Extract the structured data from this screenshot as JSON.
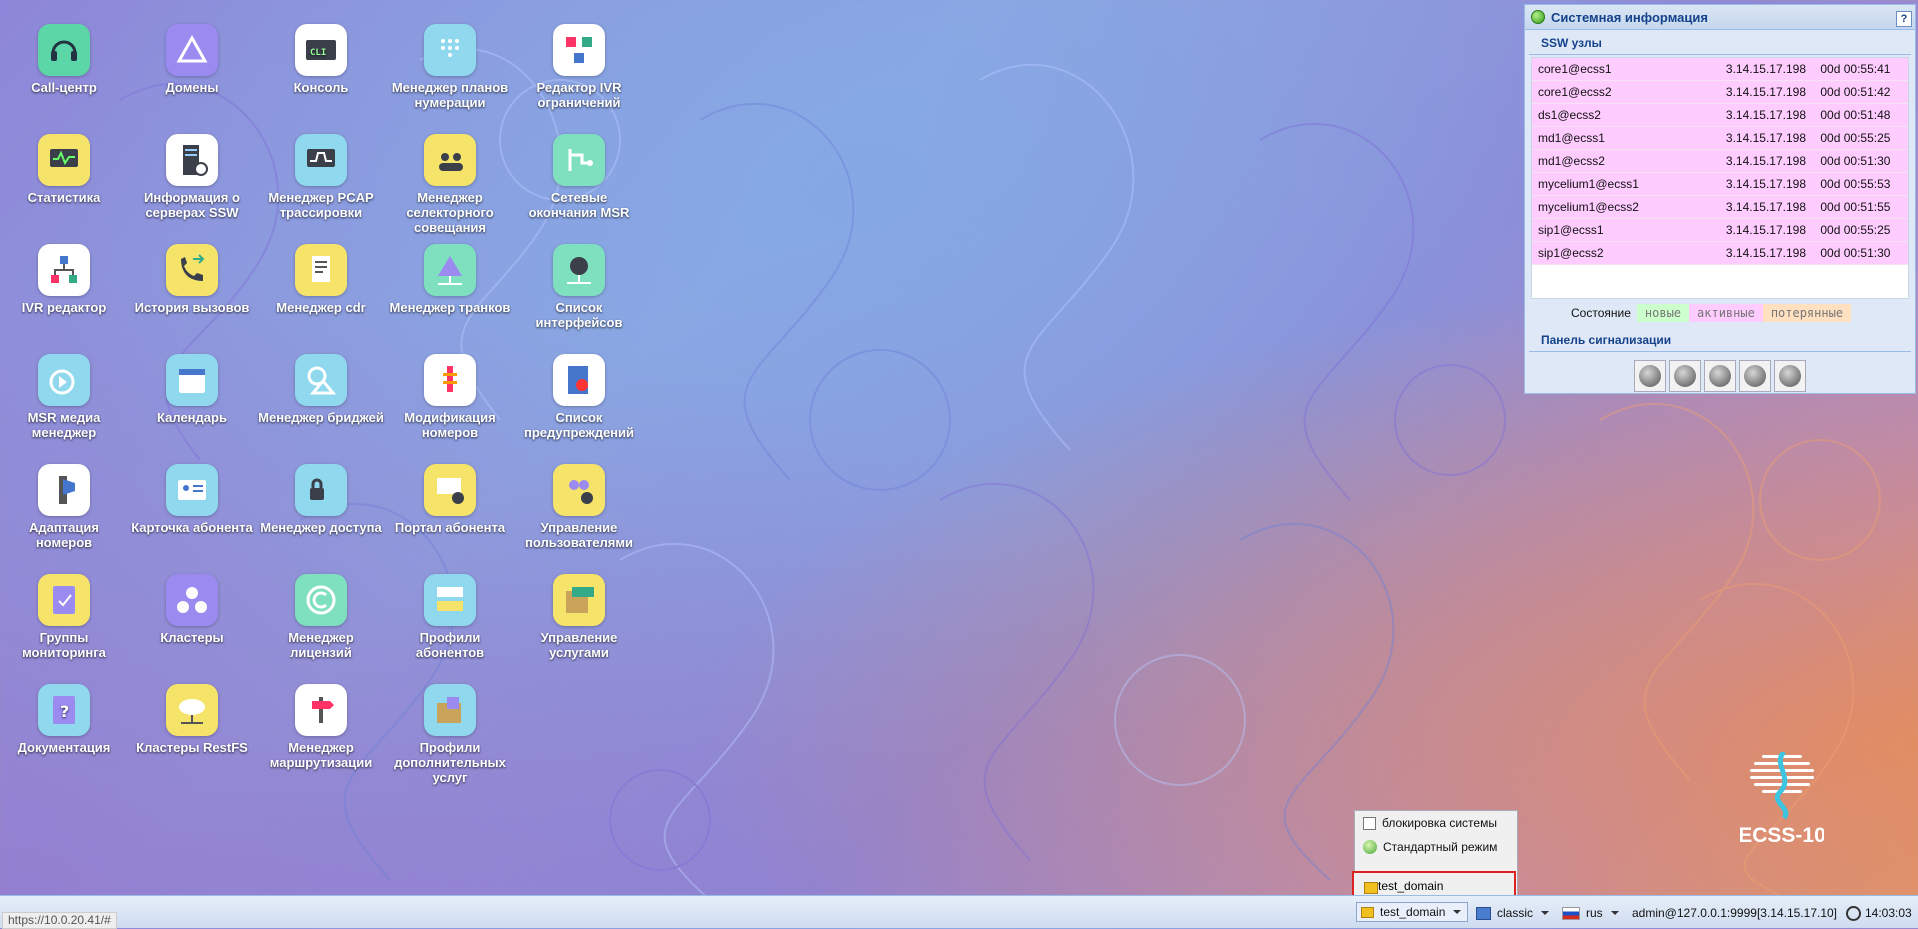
{
  "desktop": {
    "icons": [
      {
        "label": "Call-центр",
        "icon": "headset-icon",
        "color": "#5cd6a6"
      },
      {
        "label": "Домены",
        "icon": "triangle-icon",
        "color": "#9b8af0"
      },
      {
        "label": "Консоль",
        "icon": "cli-terminal-icon",
        "color": "#ffffff"
      },
      {
        "label": "Менеджер планов нумерации",
        "icon": "dialpad-phone-icon",
        "color": "#8fd8ee"
      },
      {
        "label": "Редактор IVR ограничений",
        "icon": "ivr-restriction-icon",
        "color": "#ffffff"
      },
      {
        "label": "Статистика",
        "icon": "monitor-chart-icon",
        "color": "#f5e36a"
      },
      {
        "label": "Информация о серверах SSW",
        "icon": "server-info-icon",
        "color": "#ffffff"
      },
      {
        "label": "Менеджер PCAP трассировки",
        "icon": "pcap-monitor-icon",
        "color": "#8fd8ee"
      },
      {
        "label": "Менеджер селекторного совещания",
        "icon": "conference-icon",
        "color": "#f5e36a"
      },
      {
        "label": "Сетевые окончания MSR",
        "icon": "network-endpoints-icon",
        "color": "#7fe0c0"
      },
      {
        "label": "IVR редактор",
        "icon": "ivr-tree-icon",
        "color": "#ffffff"
      },
      {
        "label": "История вызовов",
        "icon": "call-history-icon",
        "color": "#f5e36a"
      },
      {
        "label": "Менеджер cdr",
        "icon": "cdr-document-icon",
        "color": "#f5e36a"
      },
      {
        "label": "Менеджер транков",
        "icon": "trunk-icon",
        "color": "#7fe0c0"
      },
      {
        "label": "Список интерфейсов",
        "icon": "interfaces-icon",
        "color": "#7fe0c0"
      },
      {
        "label": "MSR медиа менеджер",
        "icon": "media-play-icon",
        "color": "#8fd8ee"
      },
      {
        "label": "Календарь",
        "icon": "calendar-icon",
        "color": "#8fd8ee"
      },
      {
        "label": "Менеджер бриджей",
        "icon": "bridge-shapes-icon",
        "color": "#8fd8ee"
      },
      {
        "label": "Модификация номеров",
        "icon": "number-modification-icon",
        "color": "#ffffff"
      },
      {
        "label": "Список предупреждений",
        "icon": "alarm-list-icon",
        "color": "#ffffff"
      },
      {
        "label": "Адаптация номеров",
        "icon": "number-adaptation-icon",
        "color": "#ffffff"
      },
      {
        "label": "Карточка абонента",
        "icon": "subscriber-card-icon",
        "color": "#8fd8ee"
      },
      {
        "label": "Менеджер доступа",
        "icon": "access-lock-icon",
        "color": "#8fd8ee"
      },
      {
        "label": "Портал абонента",
        "icon": "subscriber-portal-icon",
        "color": "#f5e36a"
      },
      {
        "label": "Управление пользователями",
        "icon": "users-gear-icon",
        "color": "#f5e36a"
      },
      {
        "label": "Группы мониторинга",
        "icon": "monitoring-groups-icon",
        "color": "#f5e36a"
      },
      {
        "label": "Кластеры",
        "icon": "clusters-icon",
        "color": "#9b8af0"
      },
      {
        "label": "Менеджер лицензий",
        "icon": "license-copyright-icon",
        "color": "#7fe0c0"
      },
      {
        "label": "Профили абонентов",
        "icon": "subscriber-profiles-icon",
        "color": "#8fd8ee"
      },
      {
        "label": "Управление услугами",
        "icon": "services-box-icon",
        "color": "#f5e36a"
      },
      {
        "label": "Документация",
        "icon": "documentation-book-icon",
        "color": "#8fd8ee"
      },
      {
        "label": "Кластеры RestFS",
        "icon": "restfs-cloud-icon",
        "color": "#f5e36a"
      },
      {
        "label": "Менеджер маршрутизации",
        "icon": "routing-signpost-icon",
        "color": "#ffffff"
      },
      {
        "label": "Профили дополнительных услуг",
        "icon": "additional-services-icon",
        "color": "#8fd8ee"
      }
    ]
  },
  "sysinfo": {
    "title": "Системная информация",
    "help": "?",
    "ssw_title": "SSW узлы",
    "nodes": [
      {
        "name": "core1@ecss1",
        "ip": "3.14.15.17.198",
        "uptime": "00d 00:55:41"
      },
      {
        "name": "core1@ecss2",
        "ip": "3.14.15.17.198",
        "uptime": "00d 00:51:42"
      },
      {
        "name": "ds1@ecss2",
        "ip": "3.14.15.17.198",
        "uptime": "00d 00:51:48"
      },
      {
        "name": "md1@ecss1",
        "ip": "3.14.15.17.198",
        "uptime": "00d 00:55:25"
      },
      {
        "name": "md1@ecss2",
        "ip": "3.14.15.17.198",
        "uptime": "00d 00:51:30"
      },
      {
        "name": "mycelium1@ecss1",
        "ip": "3.14.15.17.198",
        "uptime": "00d 00:55:53"
      },
      {
        "name": "mycelium1@ecss2",
        "ip": "3.14.15.17.198",
        "uptime": "00d 00:51:55"
      },
      {
        "name": "sip1@ecss1",
        "ip": "3.14.15.17.198",
        "uptime": "00d 00:55:25"
      },
      {
        "name": "sip1@ecss2",
        "ip": "3.14.15.17.198",
        "uptime": "00d 00:51:30"
      }
    ],
    "legend": {
      "label": "Состояние",
      "new": "новые",
      "active": "активные",
      "lost": "потерянные",
      "colors": {
        "new": "#ccffcc",
        "active": "#ffccff",
        "lost": "#ffe0c0"
      }
    },
    "signal_title": "Панель сигнализации"
  },
  "popup": {
    "lock_label": "блокировка системы",
    "mode_label": "Стандартный режим",
    "domain_label": "test_domain"
  },
  "taskbar": {
    "url": "https://10.0.20.41/#",
    "domain": "test_domain",
    "theme": "classic",
    "lang": "rus",
    "user": "admin@127.0.0.1:9999[3.14.15.17.10]",
    "clock": "14:03:03"
  },
  "logo": {
    "text": "ECSS-10"
  }
}
